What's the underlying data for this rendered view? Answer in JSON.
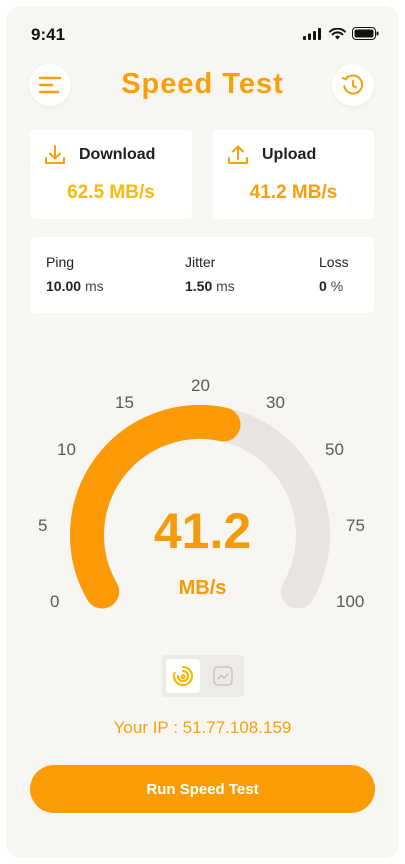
{
  "status_bar": {
    "time": "9:41"
  },
  "header": {
    "title": "Speed Test",
    "menu_icon": "menu-icon",
    "history_icon": "history-icon"
  },
  "download": {
    "label": "Download",
    "value": "62.5 MB/s",
    "icon": "download-icon"
  },
  "upload": {
    "label": "Upload",
    "value": "41.2 MB/s",
    "icon": "upload-icon"
  },
  "stats": [
    {
      "label": "Ping",
      "value": "10.00",
      "unit": "ms"
    },
    {
      "label": "Jitter",
      "value": "1.50",
      "unit": "ms"
    },
    {
      "label": "Loss",
      "value": "0",
      "unit": "%"
    }
  ],
  "gauge": {
    "value": "41.2",
    "unit": "MB/s",
    "scale_labels": [
      "0",
      "5",
      "10",
      "15",
      "20",
      "30",
      "50",
      "75",
      "100"
    ],
    "fill_fraction": 0.55,
    "fill_color": "#fb9a05",
    "track_color": "#e8e4df"
  },
  "view_toggle": {
    "options": [
      "gauge-view-icon",
      "chart-view-icon"
    ],
    "active": 0
  },
  "ip": {
    "text": "Your IP : 51.77.108.159"
  },
  "run_button": {
    "label": "Run Speed Test"
  },
  "colors": {
    "accent": "#f8a00c",
    "background": "#f7f6f3"
  }
}
